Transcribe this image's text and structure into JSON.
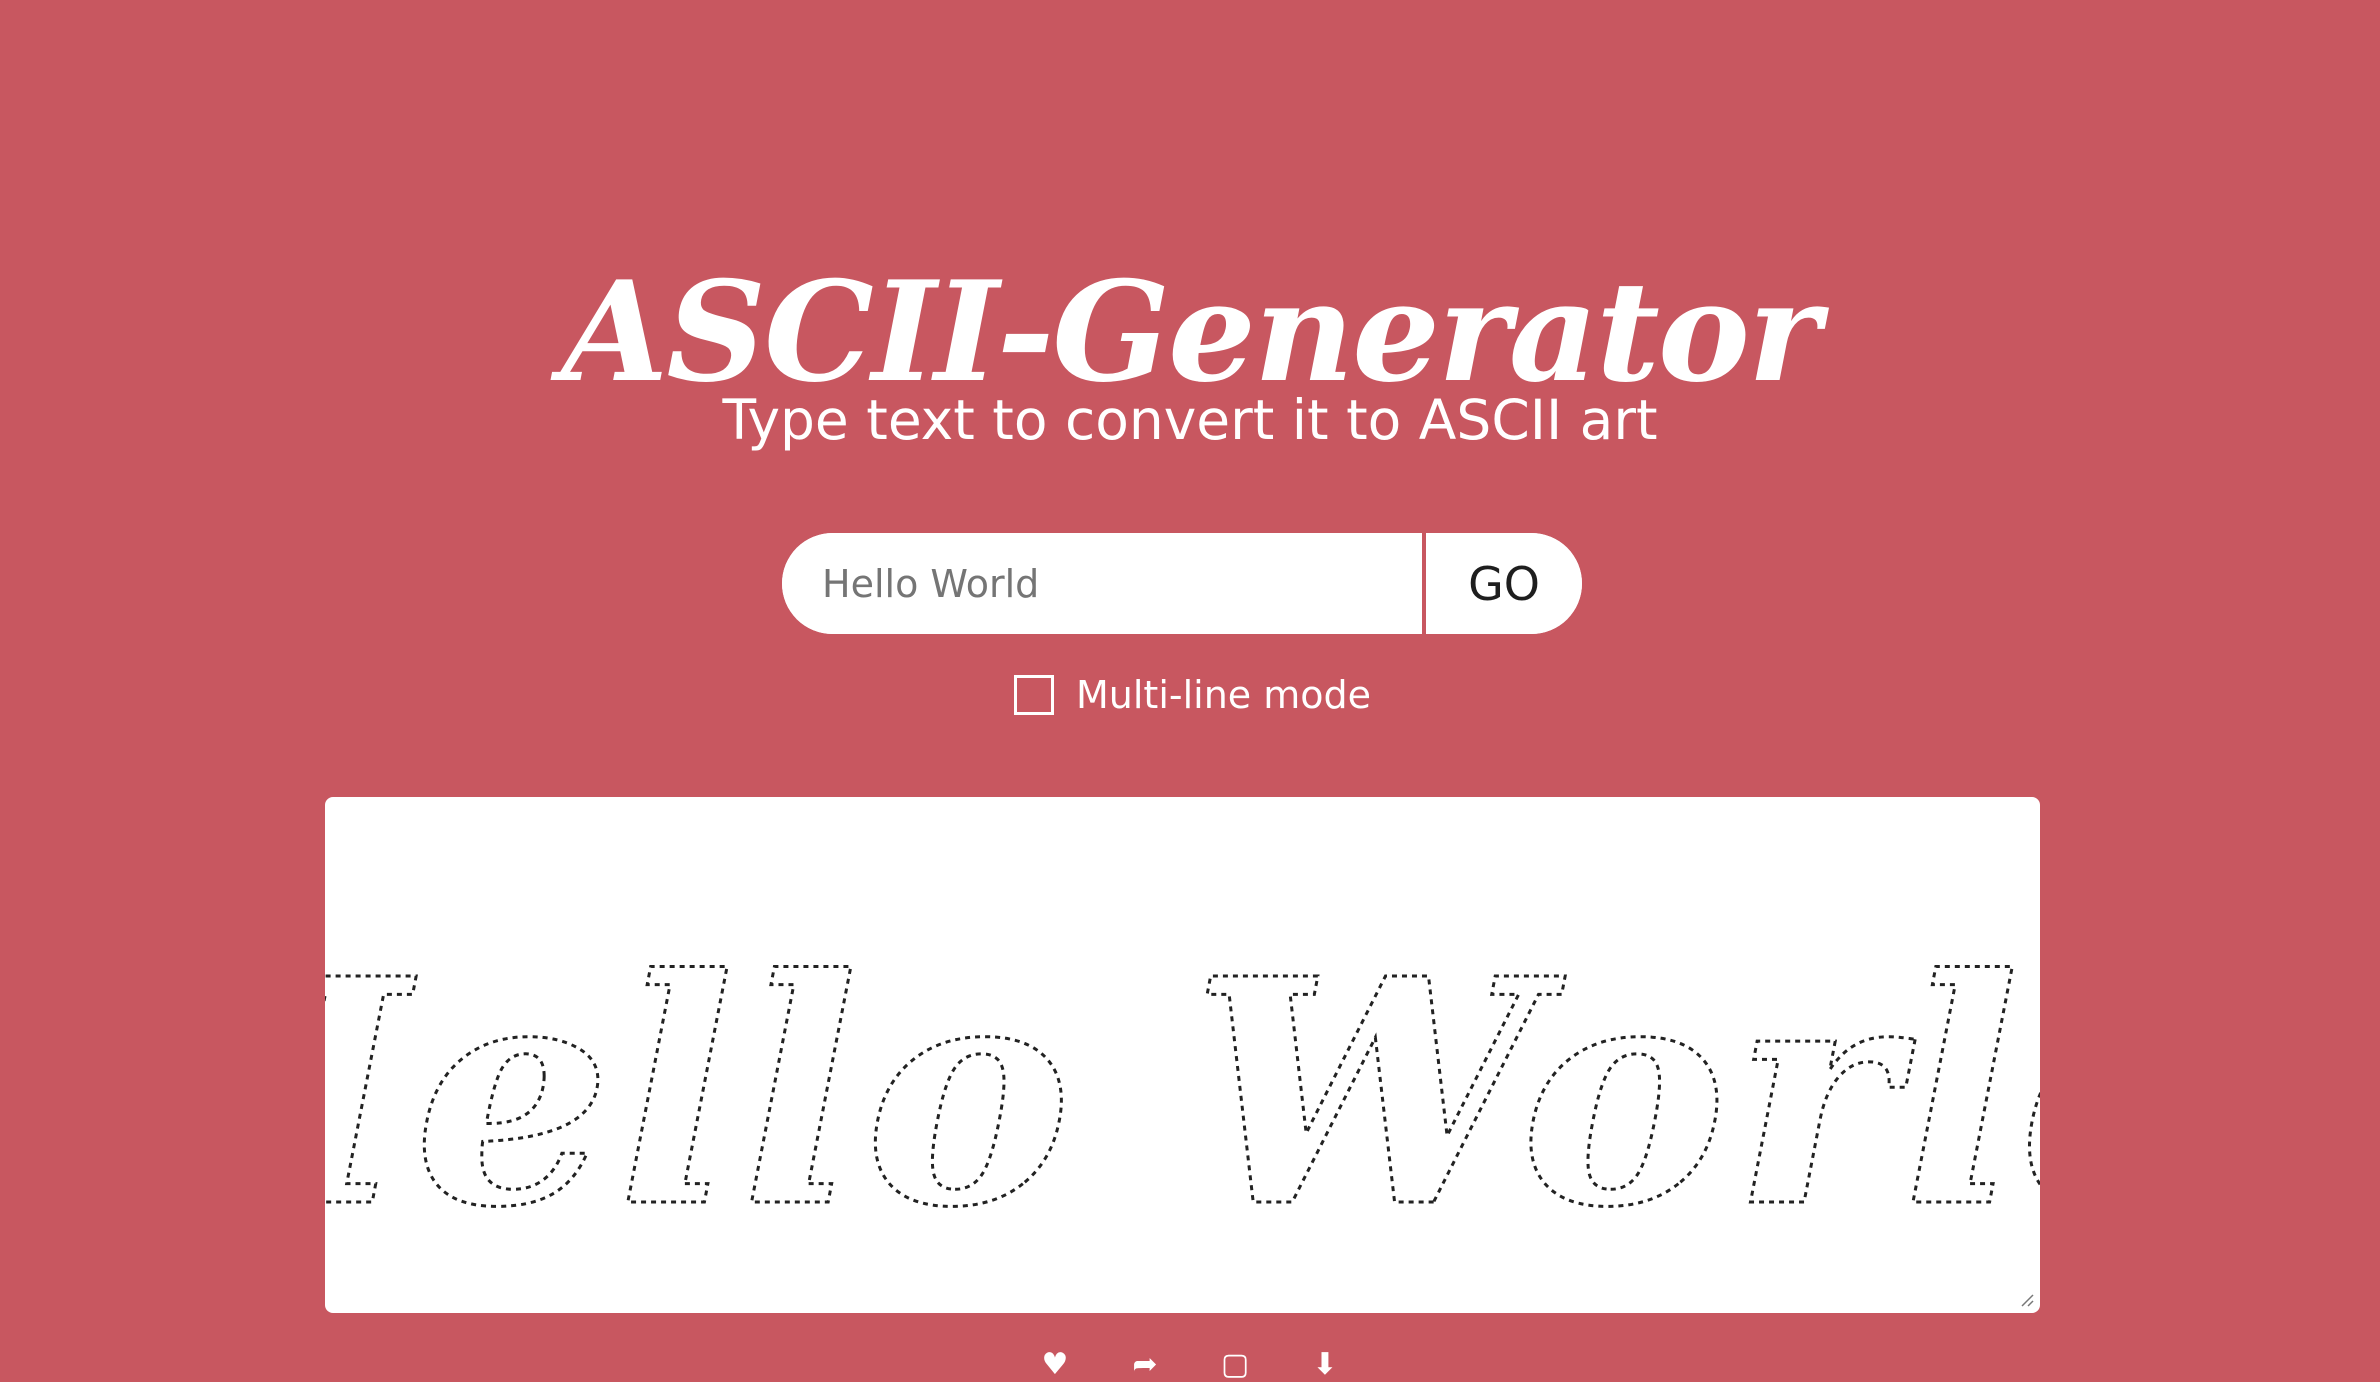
{
  "header": {
    "title": "ASCII-Generator",
    "subtitle": "Type text to convert it to ASCII art"
  },
  "form": {
    "input_value": "",
    "input_placeholder": "Hello World",
    "go_label": "GO",
    "multiline_label": "Multi-line mode",
    "multiline_checked": false
  },
  "output": {
    "art_text": "Hello World",
    "art_style": "3D outline"
  },
  "footer": {
    "icons": [
      "heart-icon",
      "share-icon",
      "copy-icon",
      "download-icon"
    ]
  },
  "colors": {
    "background": "#c85760",
    "panel": "#ffffff",
    "text": "#ffffff",
    "art": "#222222"
  }
}
